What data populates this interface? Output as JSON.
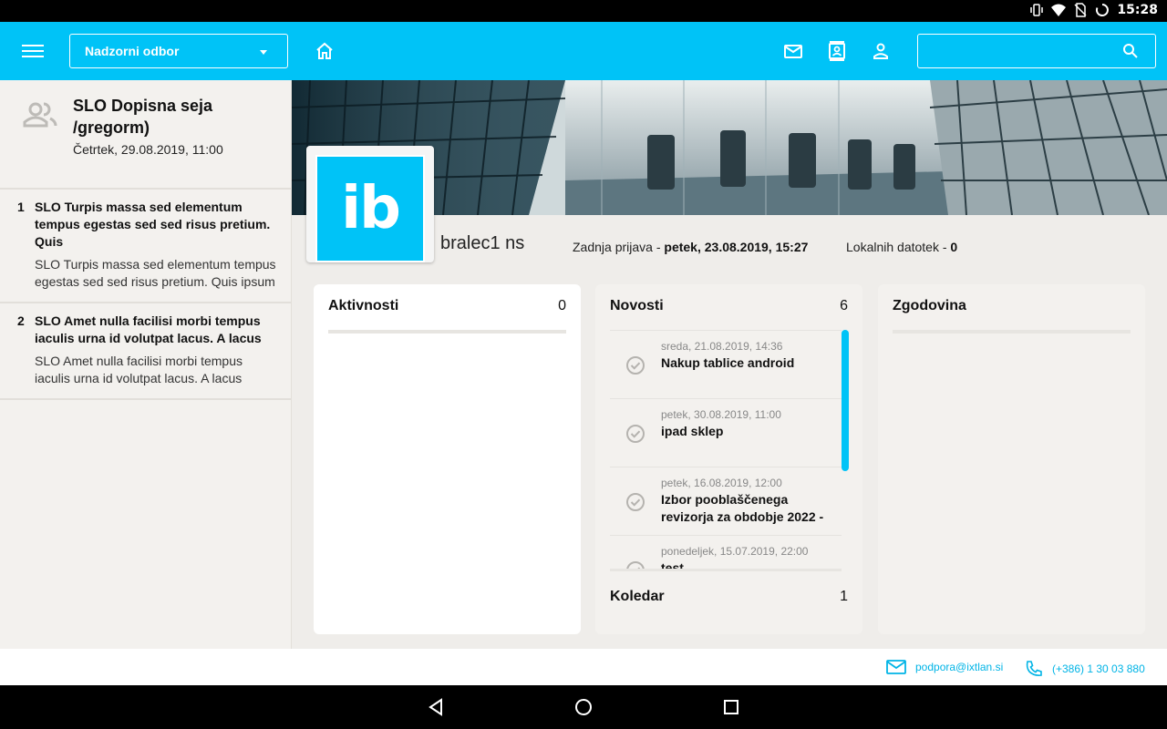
{
  "status_bar": {
    "time": "15:28",
    "icons": [
      "vibrate-icon",
      "wifi-icon",
      "no-sim-icon",
      "sync-icon"
    ]
  },
  "toolbar": {
    "org_selector": "Nadzorni odbor",
    "search_placeholder": "",
    "icons": [
      "menu-icon",
      "home-icon",
      "mail-icon",
      "contacts-icon",
      "profile-icon",
      "search-icon"
    ],
    "accent_color": "#00c3f7"
  },
  "sidebar": {
    "meeting_title": "SLO Dopisna seja /gregorm)",
    "meeting_date": "Četrtek, 29.08.2019, 11:00",
    "agenda": [
      {
        "num": "1",
        "title": "SLO Turpis massa sed elementum tempus egestas sed sed risus pretium. Quis",
        "desc": "SLO Turpis massa sed elementum tempus egestas sed sed risus pretium. Quis ipsum"
      },
      {
        "num": "2",
        "title": "SLO Amet nulla facilisi morbi tempus iaculis urna id volutpat lacus. A lacus",
        "desc": "SLO Amet nulla facilisi morbi tempus iaculis urna id volutpat lacus. A lacus"
      }
    ]
  },
  "profile": {
    "logo_text": "ib",
    "user_name": "bralec1 ns",
    "last_login_label": "Zadnja prijava - ",
    "last_login_value": "petek, 23.08.2019, 15:27",
    "local_files_label": "Lokalnih datotek - ",
    "local_files_value": "0"
  },
  "cards": {
    "aktivnosti": {
      "title": "Aktivnosti",
      "count": "0"
    },
    "novosti": {
      "title": "Novosti",
      "count": "6",
      "items": [
        {
          "date": "sreda, 21.08.2019, 14:36",
          "title": "Nakup tablice android"
        },
        {
          "date": "petek, 30.08.2019, 11:00",
          "title": "ipad sklep"
        },
        {
          "date": "petek, 16.08.2019, 12:00",
          "title": "Izbor pooblaščenega revizorja za obdobje 2022 -"
        },
        {
          "date": "ponedeljek, 15.07.2019, 22:00",
          "title": "test"
        }
      ]
    },
    "koledar": {
      "title": "Koledar",
      "count": "1"
    },
    "zgodovina": {
      "title": "Zgodovina"
    }
  },
  "footer": {
    "email": "podpora@ixtlan.si",
    "phone": "(+386) 1 30 03 880"
  }
}
